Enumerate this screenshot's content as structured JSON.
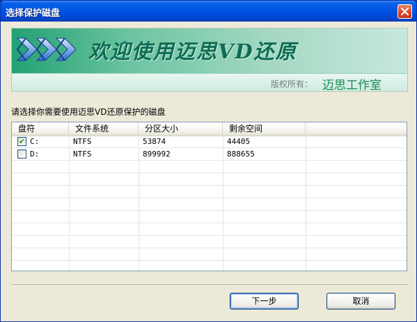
{
  "window": {
    "title": "选择保护磁盘"
  },
  "banner": {
    "slogan": "欢迎使用迈思VD还原",
    "copyright_label": "版权所有：",
    "copyright_value": "迈思工作室"
  },
  "prompt": "请选择你需要使用迈思VD还原保护的磁盘",
  "table": {
    "columns": [
      "盘符",
      "文件系统",
      "分区大小",
      "剩余空间"
    ],
    "rows": [
      {
        "checked": true,
        "drive": "C:",
        "fs": "NTFS",
        "size": "53874",
        "free": "44405"
      },
      {
        "checked": false,
        "drive": "D:",
        "fs": "NTFS",
        "size": "899992",
        "free": "888655"
      }
    ]
  },
  "buttons": {
    "next": "下一步",
    "cancel": "取消"
  },
  "icons": {
    "close": "close-icon",
    "logo": "brand-logo-icon",
    "checkbox": "checkbox-icon"
  },
  "colors": {
    "titlebar": "#0055e5",
    "banner_green": "#22a173",
    "slogan": "#0d6b53"
  }
}
